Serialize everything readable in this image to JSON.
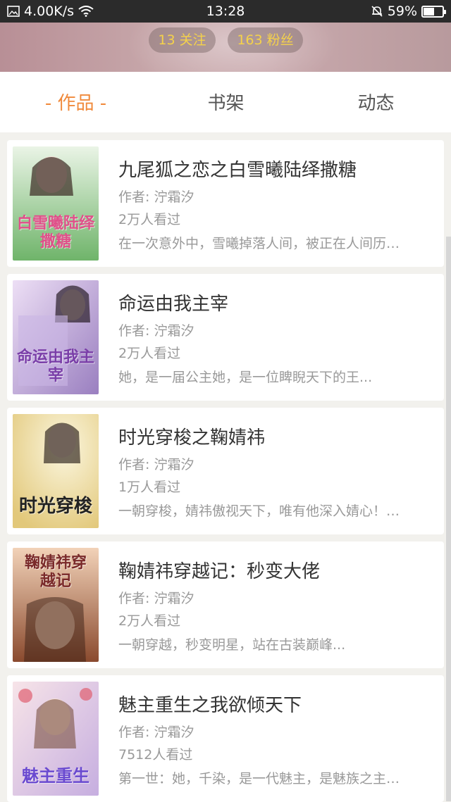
{
  "status_bar": {
    "speed": "4.00K/s",
    "time": "13:28",
    "battery": "59%",
    "battery_level": 0.59
  },
  "profile": {
    "following": "13 关注",
    "fans": "163 粉丝"
  },
  "tabs": [
    {
      "label": "作品",
      "active": true
    },
    {
      "label": "书架",
      "active": false
    },
    {
      "label": "动态",
      "active": false
    }
  ],
  "tab_dash": "-",
  "books": [
    {
      "title": "九尾狐之恋之白雪曦陆绎撒糖",
      "author": "作者: 泞霜汐",
      "views": "2万人看过",
      "desc": "在一次意外中，雪曦掉落人间，被正在人间历…",
      "cover_text": "白雪曦陆绎撒糖",
      "cover_colors": [
        "#cfe6c8",
        "#7fb87a"
      ],
      "cover_text_color": "#e0508a"
    },
    {
      "title": "命运由我主宰",
      "author": "作者: 泞霜汐",
      "views": "2万人看过",
      "desc": "她，是一届公主她，是一位睥睨天下的王...",
      "cover_text": "命运由我主宰",
      "cover_colors": [
        "#d8c8e8",
        "#9a7fc0"
      ],
      "cover_text_color": "#7a3ea8"
    },
    {
      "title": "时光穿梭之鞠婧祎",
      "author": "作者: 泞霜汐",
      "views": "1万人看过",
      "desc": "一朝穿梭，婧祎傲视天下，唯有他深入婧心！…",
      "cover_text": "时光穿梭",
      "cover_colors": [
        "#f3ecc8",
        "#e2c87a"
      ],
      "cover_text_color": "#222222"
    },
    {
      "title": "鞠婧祎穿越记：秒变大佬",
      "author": "作者: 泞霜汐",
      "views": "2万人看过",
      "desc": "一朝穿越，秒变明星，站在古装巅峰...",
      "cover_text": "鞠婧祎穿越记",
      "cover_colors": [
        "#e8b898",
        "#9a5a3a"
      ],
      "cover_text_color": "#7a2a2a"
    },
    {
      "title": "魅主重生之我欲倾天下",
      "author": "作者: 泞霜汐",
      "views": "7512人看过",
      "desc": "第一世：她，千染，是一代魅主，是魅族之主…",
      "cover_text": "魅主重生",
      "cover_colors": [
        "#f2d6dc",
        "#b89ad0"
      ],
      "cover_text_color": "#6a4ad0"
    }
  ],
  "colors": {
    "accent": "#f08a3c",
    "pill_text": "#f5d24a"
  }
}
